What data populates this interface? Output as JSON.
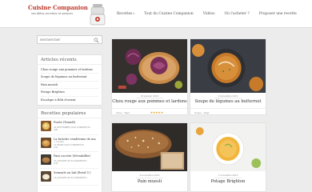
{
  "header": {
    "logo_title": "Cuisine Companion",
    "logo_subtitle": "ses idées recettes et astuces",
    "nav": [
      {
        "label": "Recettes",
        "has_dropdown": true
      },
      {
        "label": "Tout du Cuisine Companion",
        "has_dropdown": false
      },
      {
        "label": "Vidéos",
        "has_dropdown": false
      },
      {
        "label": "Où l'acheter ?",
        "has_dropdown": false
      },
      {
        "label": "Proposer une recette",
        "has_dropdown": false
      }
    ]
  },
  "search": {
    "placeholder": "Rechercher"
  },
  "recent": {
    "title": "Articles récents",
    "items": [
      "Chou rouge aux pommes et lardons",
      "Soupe de légumes au butternut",
      "Pain muesli",
      "Potage Brighton",
      "Escalope à Rôti d'orient"
    ]
  },
  "popular": {
    "title": "Recettes populaires",
    "items": [
      {
        "title": "Purée (TomeR)",
        "meta": "22 DÉCEMBRE 2016 COMMENTS",
        "meta2": "(28)"
      },
      {
        "title": "La brioche vendéenne de ma",
        "title2": "», recette",
        "meta": "19 MARS 2016 COMMENTS",
        "meta2": "(19)"
      },
      {
        "title": "Pain cocotte (Sévrakiller)",
        "meta": "25 JANVIER 2016 COMMENTS",
        "meta2": "(16)"
      },
      {
        "title": "Semoule au lait (Reed U.)",
        "meta": "18 JANVIER 2016 COMMENTS",
        "meta2": ""
      }
    ]
  },
  "cards": [
    {
      "date": "25 janvier 2016",
      "title": "Chou rouge aux pommes et lardons",
      "meta": "Chou · Tags:",
      "rating": 5
    },
    {
      "date": "3 décembre 2016",
      "title": "Soupe de légumes au butternut",
      "meta": "Soupe · Tags: ",
      "rating": 0
    },
    {
      "date": "4 novembre 2016",
      "title": "Pain muesli",
      "meta": "",
      "rating": 0
    },
    {
      "date": "1 novembre 2016",
      "title": "Potage Brighton",
      "meta": "",
      "rating": 0
    }
  ],
  "colors": {
    "brand": "#c0392b",
    "star": "#e4a62c",
    "background": "#ececec"
  }
}
